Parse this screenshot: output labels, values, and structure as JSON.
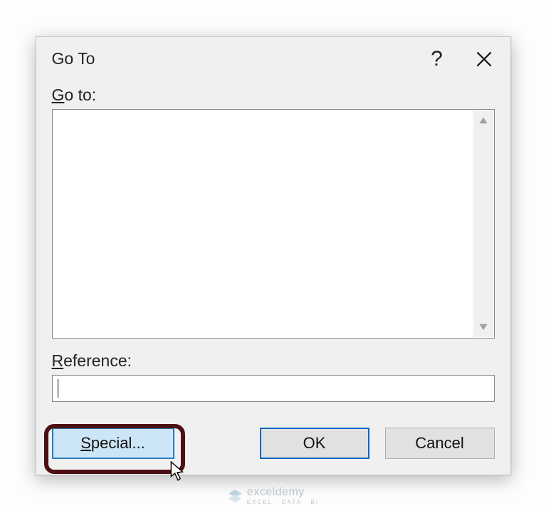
{
  "dialog": {
    "title": "Go To",
    "help_tooltip": "?",
    "close_tooltip": "Close"
  },
  "labels": {
    "goto_prefix": "G",
    "goto_rest": "o to:",
    "reference_prefix": "R",
    "reference_rest": "eference:"
  },
  "inputs": {
    "reference_value": ""
  },
  "buttons": {
    "special_prefix": "S",
    "special_rest": "pecial...",
    "ok": "OK",
    "cancel": "Cancel"
  },
  "watermark": {
    "brand": "exceldemy",
    "tagline": "EXCEL · DATA · BI"
  }
}
